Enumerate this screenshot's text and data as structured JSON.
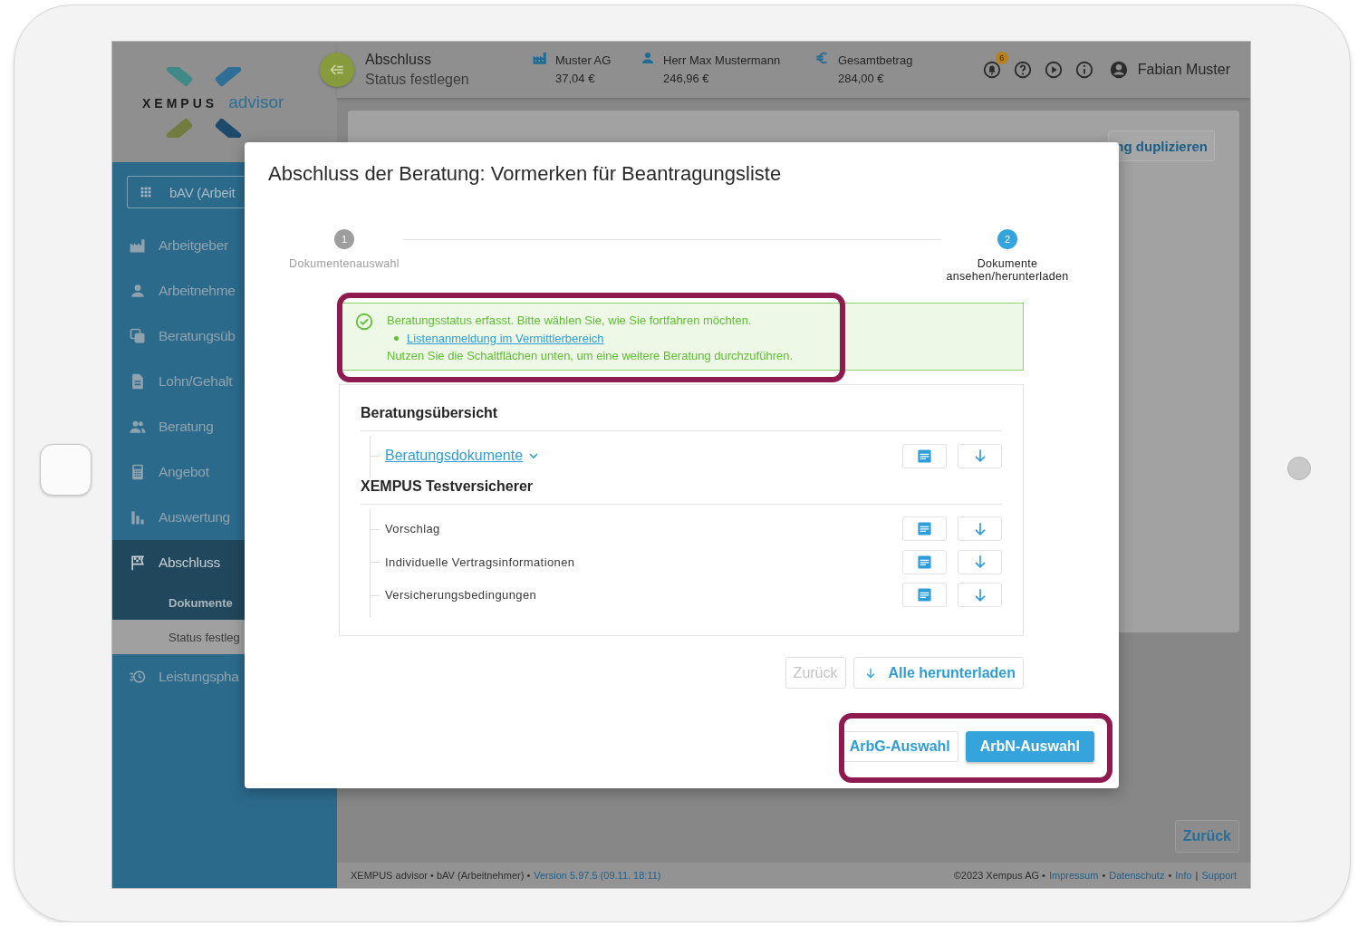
{
  "logo": {
    "brand": "XEMPUS",
    "product": "advisor"
  },
  "header": {
    "title": "Abschluss",
    "subtitle": "Status festlegen",
    "infos": [
      {
        "kind": "company",
        "label": "Muster AG",
        "value": "37,04 €"
      },
      {
        "kind": "person",
        "label": "Herr Max Mustermann",
        "value": "246,96 €"
      },
      {
        "kind": "money",
        "label": "Gesamtbetrag",
        "value": "284,00 €"
      }
    ],
    "notification_count": "6",
    "user": "Fabian Muster"
  },
  "sidebar": {
    "selector": "bAV (Arbeit",
    "items": [
      {
        "label": "Arbeitgeber",
        "selected": false,
        "expanded": false
      },
      {
        "label": "Arbeitnehme",
        "selected": false,
        "expanded": false
      },
      {
        "label": "Beratungsüb",
        "selected": false,
        "expanded": false
      },
      {
        "label": "Lohn/Gehalt",
        "selected": false,
        "expanded": false
      },
      {
        "label": "Beratung",
        "selected": false,
        "expanded": false
      },
      {
        "label": "Angebot",
        "selected": false,
        "expanded": false
      },
      {
        "label": "Auswertung",
        "selected": false,
        "expanded": false
      },
      {
        "label": "Abschluss",
        "selected": true,
        "expanded": true,
        "children": [
          {
            "label": "Dokumente",
            "selected": false
          },
          {
            "label": "Status festleg",
            "selected": true
          }
        ]
      },
      {
        "label": "Leistungspha",
        "selected": false,
        "expanded": false
      }
    ]
  },
  "background_card": {
    "button": "ng duplizieren",
    "back_button": "Zurück"
  },
  "footer": {
    "left": [
      {
        "kind": "text",
        "text": "XEMPUS advisor • bAV (Arbeitnehmer) •"
      },
      {
        "kind": "link",
        "text": "Version 5.97.5 (09.11. 18:11)"
      }
    ],
    "right": [
      {
        "kind": "text",
        "text": "©2023 Xempus AG •"
      },
      {
        "kind": "link",
        "text": "Impressum"
      },
      {
        "kind": "text",
        "text": "•"
      },
      {
        "kind": "link",
        "text": "Datenschutz"
      },
      {
        "kind": "text",
        "text": "•"
      },
      {
        "kind": "link",
        "text": "Info"
      },
      {
        "kind": "text",
        "text": "|"
      },
      {
        "kind": "link",
        "text": "Support"
      }
    ]
  },
  "modal": {
    "title": "Abschluss der Beratung: Vormerken für Beantragungsliste",
    "steps": [
      {
        "number": "1",
        "label": "Dokumentenauswahl",
        "selected": false
      },
      {
        "number": "2",
        "label": "Dokumente ansehen/herunterladen",
        "selected": true
      }
    ],
    "alert": {
      "message": "Beratungsstatus erfasst. Bitte wählen Sie, wie Sie fortfahren möchten.",
      "link": "Listenanmeldung im Vermittlerbereich",
      "note": "Nutzen Sie die Schaltflächen unten, um eine weitere Beratung durchzuführen."
    },
    "sections": [
      {
        "title": "Beratungsübersicht",
        "documents": [
          {
            "kind": "link",
            "label": "Beratungsdokumente"
          }
        ]
      },
      {
        "title": "XEMPUS Testversicherer",
        "documents": [
          {
            "kind": "plain",
            "label": "Vorschlag"
          },
          {
            "kind": "plain",
            "label": "Individuelle Vertragsinformationen"
          },
          {
            "kind": "plain",
            "label": "Versicherungsbedingungen"
          }
        ]
      }
    ],
    "actions": [
      {
        "kind": "plain",
        "label": "Zurück",
        "disabled": true
      },
      {
        "kind": "download",
        "label": "Alle herunterladen",
        "disabled": false
      }
    ],
    "final_actions": [
      {
        "label": "ArbG-Auswahl",
        "primary": false
      },
      {
        "label": "ArbN-Auswahl",
        "primary": true
      }
    ]
  }
}
